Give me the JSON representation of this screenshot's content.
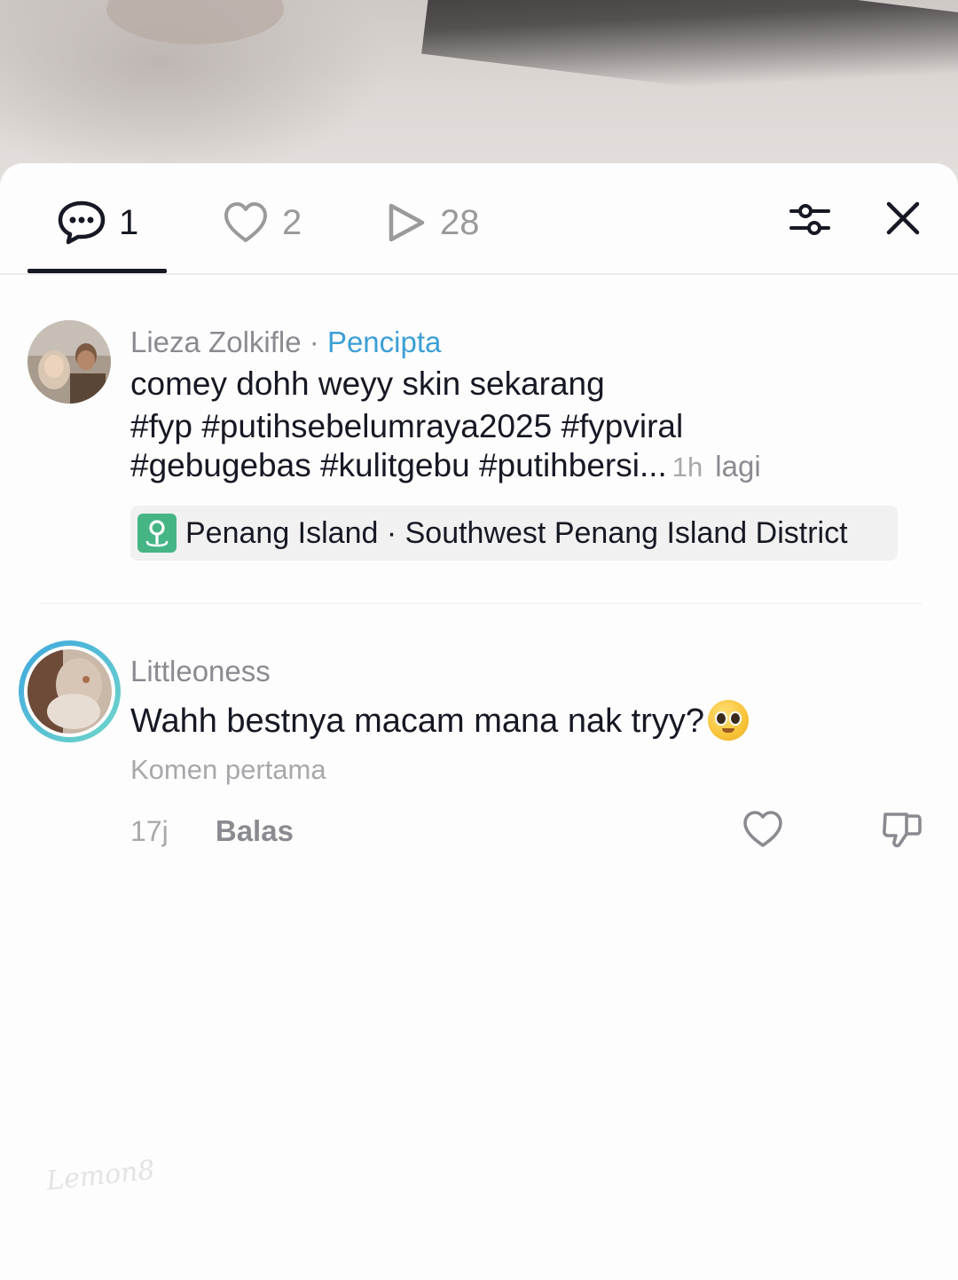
{
  "tabs": [
    {
      "icon": "comment-icon",
      "count": "1",
      "active": true
    },
    {
      "icon": "heart-icon",
      "count": "2",
      "active": false
    },
    {
      "icon": "play-icon",
      "count": "28",
      "active": false
    }
  ],
  "header_actions": {
    "filter_icon": "sliders-icon",
    "close_icon": "close-icon"
  },
  "caption": {
    "author": "Lieza Zolkifle",
    "separator": "·",
    "role": "Pencipta",
    "lines": [
      "comey dohh weyy skin sekarang",
      "#fyp #putihsebelumraya2025 #fypviral",
      "#gebugebas #kulitgebu #putihbersi..."
    ],
    "time": "1h",
    "more_label": "lagi",
    "location": "Penang Island · Southwest Penang Island District"
  },
  "comments": [
    {
      "author": "Littleoness",
      "text": "Wahh bestnya macam mana nak tryy?",
      "emoji": "pleading-face-emoji",
      "sub_label": "Komen pertama",
      "time": "17j",
      "reply_label": "Balas"
    }
  ],
  "watermark": "Lemon8",
  "colors": {
    "creator_blue": "#3d9fd4",
    "location_green": "#46b586",
    "text_primary": "#161823",
    "text_secondary": "#8a8b91"
  }
}
